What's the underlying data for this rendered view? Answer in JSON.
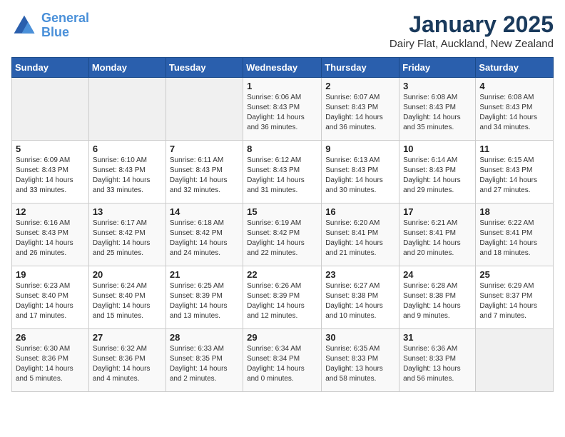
{
  "header": {
    "logo_line1": "General",
    "logo_line2": "Blue",
    "title": "January 2025",
    "subtitle": "Dairy Flat, Auckland, New Zealand"
  },
  "days_of_week": [
    "Sunday",
    "Monday",
    "Tuesday",
    "Wednesday",
    "Thursday",
    "Friday",
    "Saturday"
  ],
  "weeks": [
    [
      {
        "day": "",
        "info": ""
      },
      {
        "day": "",
        "info": ""
      },
      {
        "day": "",
        "info": ""
      },
      {
        "day": "1",
        "info": "Sunrise: 6:06 AM\nSunset: 8:43 PM\nDaylight: 14 hours\nand 36 minutes."
      },
      {
        "day": "2",
        "info": "Sunrise: 6:07 AM\nSunset: 8:43 PM\nDaylight: 14 hours\nand 36 minutes."
      },
      {
        "day": "3",
        "info": "Sunrise: 6:08 AM\nSunset: 8:43 PM\nDaylight: 14 hours\nand 35 minutes."
      },
      {
        "day": "4",
        "info": "Sunrise: 6:08 AM\nSunset: 8:43 PM\nDaylight: 14 hours\nand 34 minutes."
      }
    ],
    [
      {
        "day": "5",
        "info": "Sunrise: 6:09 AM\nSunset: 8:43 PM\nDaylight: 14 hours\nand 33 minutes."
      },
      {
        "day": "6",
        "info": "Sunrise: 6:10 AM\nSunset: 8:43 PM\nDaylight: 14 hours\nand 33 minutes."
      },
      {
        "day": "7",
        "info": "Sunrise: 6:11 AM\nSunset: 8:43 PM\nDaylight: 14 hours\nand 32 minutes."
      },
      {
        "day": "8",
        "info": "Sunrise: 6:12 AM\nSunset: 8:43 PM\nDaylight: 14 hours\nand 31 minutes."
      },
      {
        "day": "9",
        "info": "Sunrise: 6:13 AM\nSunset: 8:43 PM\nDaylight: 14 hours\nand 30 minutes."
      },
      {
        "day": "10",
        "info": "Sunrise: 6:14 AM\nSunset: 8:43 PM\nDaylight: 14 hours\nand 29 minutes."
      },
      {
        "day": "11",
        "info": "Sunrise: 6:15 AM\nSunset: 8:43 PM\nDaylight: 14 hours\nand 27 minutes."
      }
    ],
    [
      {
        "day": "12",
        "info": "Sunrise: 6:16 AM\nSunset: 8:43 PM\nDaylight: 14 hours\nand 26 minutes."
      },
      {
        "day": "13",
        "info": "Sunrise: 6:17 AM\nSunset: 8:42 PM\nDaylight: 14 hours\nand 25 minutes."
      },
      {
        "day": "14",
        "info": "Sunrise: 6:18 AM\nSunset: 8:42 PM\nDaylight: 14 hours\nand 24 minutes."
      },
      {
        "day": "15",
        "info": "Sunrise: 6:19 AM\nSunset: 8:42 PM\nDaylight: 14 hours\nand 22 minutes."
      },
      {
        "day": "16",
        "info": "Sunrise: 6:20 AM\nSunset: 8:41 PM\nDaylight: 14 hours\nand 21 minutes."
      },
      {
        "day": "17",
        "info": "Sunrise: 6:21 AM\nSunset: 8:41 PM\nDaylight: 14 hours\nand 20 minutes."
      },
      {
        "day": "18",
        "info": "Sunrise: 6:22 AM\nSunset: 8:41 PM\nDaylight: 14 hours\nand 18 minutes."
      }
    ],
    [
      {
        "day": "19",
        "info": "Sunrise: 6:23 AM\nSunset: 8:40 PM\nDaylight: 14 hours\nand 17 minutes."
      },
      {
        "day": "20",
        "info": "Sunrise: 6:24 AM\nSunset: 8:40 PM\nDaylight: 14 hours\nand 15 minutes."
      },
      {
        "day": "21",
        "info": "Sunrise: 6:25 AM\nSunset: 8:39 PM\nDaylight: 14 hours\nand 13 minutes."
      },
      {
        "day": "22",
        "info": "Sunrise: 6:26 AM\nSunset: 8:39 PM\nDaylight: 14 hours\nand 12 minutes."
      },
      {
        "day": "23",
        "info": "Sunrise: 6:27 AM\nSunset: 8:38 PM\nDaylight: 14 hours\nand 10 minutes."
      },
      {
        "day": "24",
        "info": "Sunrise: 6:28 AM\nSunset: 8:38 PM\nDaylight: 14 hours\nand 9 minutes."
      },
      {
        "day": "25",
        "info": "Sunrise: 6:29 AM\nSunset: 8:37 PM\nDaylight: 14 hours\nand 7 minutes."
      }
    ],
    [
      {
        "day": "26",
        "info": "Sunrise: 6:30 AM\nSunset: 8:36 PM\nDaylight: 14 hours\nand 5 minutes."
      },
      {
        "day": "27",
        "info": "Sunrise: 6:32 AM\nSunset: 8:36 PM\nDaylight: 14 hours\nand 4 minutes."
      },
      {
        "day": "28",
        "info": "Sunrise: 6:33 AM\nSunset: 8:35 PM\nDaylight: 14 hours\nand 2 minutes."
      },
      {
        "day": "29",
        "info": "Sunrise: 6:34 AM\nSunset: 8:34 PM\nDaylight: 14 hours\nand 0 minutes."
      },
      {
        "day": "30",
        "info": "Sunrise: 6:35 AM\nSunset: 8:33 PM\nDaylight: 13 hours\nand 58 minutes."
      },
      {
        "day": "31",
        "info": "Sunrise: 6:36 AM\nSunset: 8:33 PM\nDaylight: 13 hours\nand 56 minutes."
      },
      {
        "day": "",
        "info": ""
      }
    ]
  ]
}
